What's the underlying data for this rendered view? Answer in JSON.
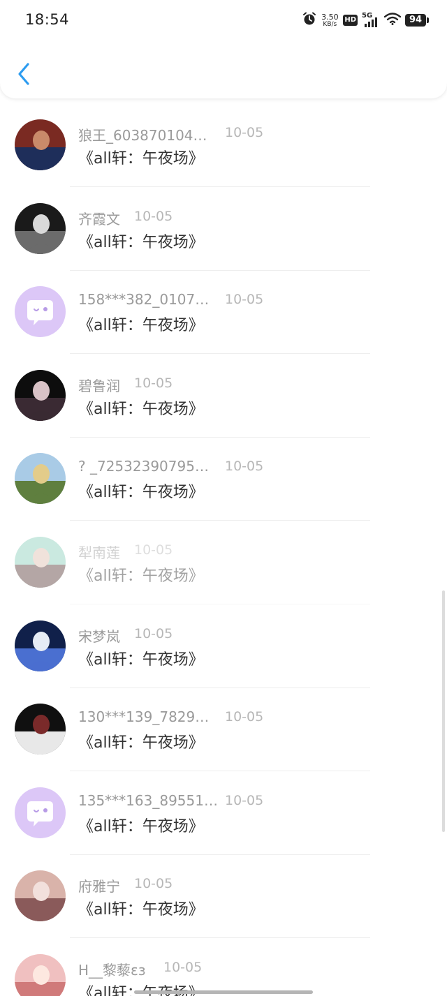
{
  "status_bar": {
    "time": "18:54",
    "net_speed_value": "3.50",
    "net_speed_unit": "KB/s",
    "hd_label": "HD",
    "network_label": "5G",
    "battery": "94"
  },
  "icons": {
    "back": "chevron-left-icon",
    "alarm": "alarm-icon",
    "wifi": "wifi-icon",
    "default_avatar": "chat-bubble-avatar-icon"
  },
  "colors": {
    "accent": "#2d9cf0",
    "name_text": "#9a9a9a",
    "date_text": "#b7b7b7",
    "title_text": "#333333",
    "default_avatar_bg": "#dcc7f7"
  },
  "items": [
    {
      "name": "狼王_603870104…",
      "date": "10-05",
      "title": "《all轩：午夜场》",
      "avatar": "photo"
    },
    {
      "name": "齐霞文",
      "date": "10-05",
      "title": "《all轩：午夜场》",
      "avatar": "photo"
    },
    {
      "name": "158***382_0107…",
      "date": "10-05",
      "title": "《all轩：午夜场》",
      "avatar": "default"
    },
    {
      "name": "碧鲁润",
      "date": "10-05",
      "title": "《all轩：午夜场》",
      "avatar": "photo"
    },
    {
      "name": "? _72532390795…",
      "date": "10-05",
      "title": "《all轩：午夜场》",
      "avatar": "photo"
    },
    {
      "name": "犁南莲",
      "date": "10-05",
      "title": "《all轩：午夜场》",
      "avatar": "photo"
    },
    {
      "name": "宋梦岚",
      "date": "10-05",
      "title": "《all轩：午夜场》",
      "avatar": "photo"
    },
    {
      "name": "130***139_7829…",
      "date": "10-05",
      "title": "《all轩：午夜场》",
      "avatar": "photo"
    },
    {
      "name": "135***163_89551…",
      "date": "10-05",
      "title": "《all轩：午夜场》",
      "avatar": "default"
    },
    {
      "name": "府雅宁",
      "date": "10-05",
      "title": "《all轩：午夜场》",
      "avatar": "photo"
    },
    {
      "name": "H__黎藜ɛɜ",
      "date": "10-05",
      "title": "《all轩：午夜场》",
      "avatar": "photo"
    }
  ]
}
